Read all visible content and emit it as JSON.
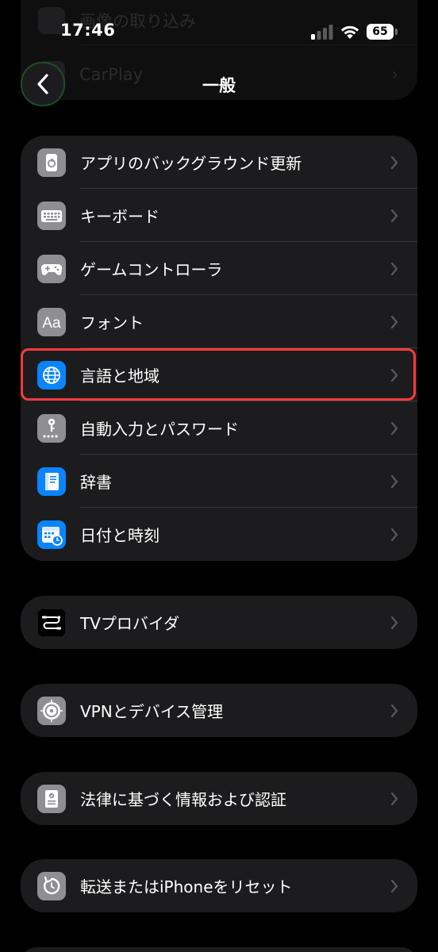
{
  "status_bar": {
    "time": "17:46",
    "battery": "65"
  },
  "background_card": {
    "items": [
      {
        "label": "画像の取り込み"
      },
      {
        "label": "CarPlay"
      }
    ]
  },
  "nav": {
    "title": "一般",
    "back_icon": "chevron-left-icon"
  },
  "groups": [
    {
      "items": [
        {
          "label": "アプリのバックグラウンド更新",
          "icon": "background-refresh-icon"
        },
        {
          "label": "キーボード",
          "icon": "keyboard-icon"
        },
        {
          "label": "ゲームコントローラ",
          "icon": "game-controller-icon"
        },
        {
          "label": "フォント",
          "icon": "font-icon"
        },
        {
          "label": "言語と地域",
          "icon": "globe-icon"
        },
        {
          "label": "自動入力とパスワード",
          "icon": "key-icon"
        },
        {
          "label": "辞書",
          "icon": "dictionary-icon"
        },
        {
          "label": "日付と時刻",
          "icon": "calendar-clock-icon"
        }
      ]
    },
    {
      "items": [
        {
          "label": "TVプロバイダ",
          "icon": "tv-provider-icon"
        }
      ]
    },
    {
      "items": [
        {
          "label": "VPNとデバイス管理",
          "icon": "gear-icon"
        }
      ]
    },
    {
      "items": [
        {
          "label": "法律に基づく情報および認証",
          "icon": "certificate-icon"
        }
      ]
    },
    {
      "items": [
        {
          "label": "転送またはiPhoneをリセット",
          "icon": "reset-icon"
        }
      ]
    }
  ],
  "colors": {
    "background": "#000000",
    "card": "#1c1c1e",
    "separator": "#38383a",
    "highlight": "#ff3b3b",
    "blue_icon": "#0a84ff",
    "gray_icon": "#8e8e93"
  }
}
